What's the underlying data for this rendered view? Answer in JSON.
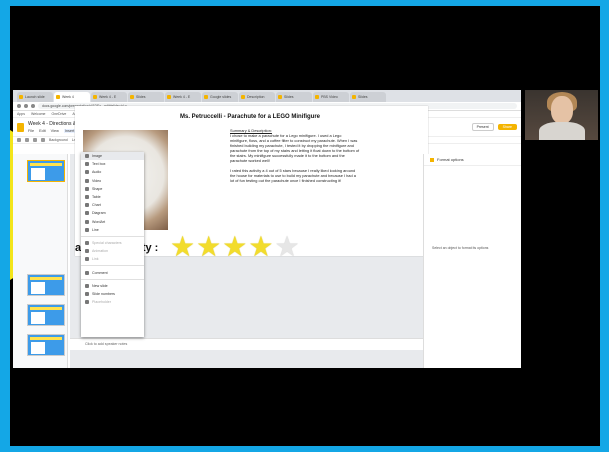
{
  "browser": {
    "tabs": [
      "Launch slide",
      "Week 4",
      "Week 4 - E",
      "Slides",
      "Week 4 - E",
      "Google slides",
      "Description",
      "Slides",
      "PBS Video",
      "Slides"
    ],
    "url": "docs.google.com/presentation/d/1DEx...edit#slide=id.g...",
    "bookmarks": [
      "Apps",
      "Welcome",
      "OneDrive",
      "Amazon Prime",
      "Teaching",
      "Twitter",
      "Chromebook 2"
    ]
  },
  "doc": {
    "title": "Week 4 - Directions & Example DAC",
    "menu": [
      "File",
      "Edit",
      "View",
      "Insert",
      "Format",
      "Slide",
      "Arrange",
      "Tools",
      "Add-ons",
      "Help"
    ],
    "present_label": "Present",
    "share_label": "Share",
    "toolbar": [
      "Background",
      "Layout",
      "Theme",
      "Transition"
    ]
  },
  "insert_menu": {
    "items": [
      "Image",
      "Text box",
      "Audio",
      "Video",
      "Shape",
      "Table",
      "Chart",
      "Diagram",
      "WordArt",
      "Line",
      "Special characters",
      "Animation",
      "Link",
      "Comment",
      "New slide",
      "Slide numbers",
      "Placeholder"
    ],
    "disabled": [
      "Special characters",
      "Animation",
      "Link",
      "Placeholder"
    ]
  },
  "slide": {
    "title": "Ms. Petruccelli - Parachute for a LEGO Minifigure",
    "summary_heading": "Summary & Description:",
    "summary": "I chose to make a parachute for a Lego minifigure. I used a Lego minifigure, floss, and a coffee filter to construct my parachute. When I was finished building my parachute, I tested it by dropping the minifigure and parachute from the top of my stairs and letting it float down to the bottom of the stairs. My minifigure successfully made it to the bottom and the parachute worked well!",
    "rating_text": "I rated this activity a 4 out of 5 stars because I really liked looking around the house for materials to use to build my parachute and because I had a lot of fun testing out the parachute once I finished constructing it!",
    "rate_label": "ate My Activity :",
    "rating": 4,
    "rating_max": 5
  },
  "notes": {
    "placeholder": "Click to add speaker notes"
  },
  "side_panel": {
    "title": "Format options",
    "message": "Select an object to format its options"
  }
}
